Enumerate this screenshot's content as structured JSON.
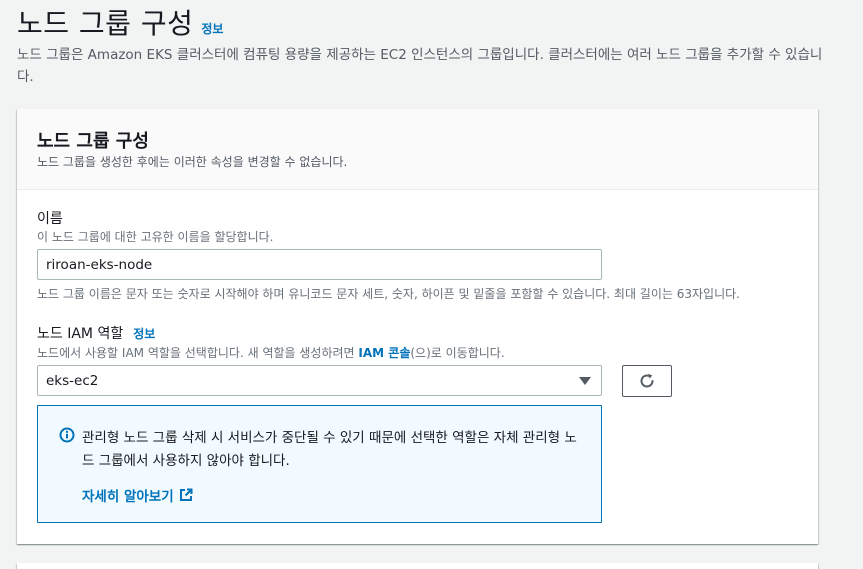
{
  "page": {
    "title": "노드 그룹 구성",
    "info_label": "정보",
    "description": "노드 그룹은 Amazon EKS 클러스터에 컴퓨팅 용량을 제공하는 EC2 인스턴스의 그룹입니다. 클러스터에는 여러 노드 그룹을 추가할 수 있습니다."
  },
  "card": {
    "title": "노드 그룹 구성",
    "subtitle": "노드 그룹을 생성한 후에는 이러한 속성을 변경할 수 없습니다."
  },
  "name_field": {
    "label": "이름",
    "description": "이 노드 그룹에 대한 고유한 이름을 할당합니다.",
    "value": "riroan-eks-node",
    "constraint": "노드 그룹 이름은 문자 또는 숫자로 시작해야 하며 유니코드 문자 세트, 숫자, 하이픈 및 밑줄을 포함할 수 있습니다. 최대 길이는 63자입니다."
  },
  "role_field": {
    "label": "노드 IAM 역할",
    "info_label": "정보",
    "description_prefix": "노드에서 사용할 IAM 역할을 선택합니다. 새 역할을 생성하려면 ",
    "description_link": "IAM 콘솔",
    "description_suffix": "(으)로 이동합니다.",
    "selected": "eks-ec2"
  },
  "alert": {
    "text": "관리형 노드 그룹 삭제 시 서비스가 중단될 수 있기 때문에 선택한 역할은 자체 관리형 노드 그룹에서 사용하지 않아야 합니다.",
    "link": "자세히 알아보기"
  },
  "colors": {
    "link": "#0073bb",
    "alert_bg": "#f1faff",
    "text": "#16191f",
    "muted": "#687078"
  }
}
